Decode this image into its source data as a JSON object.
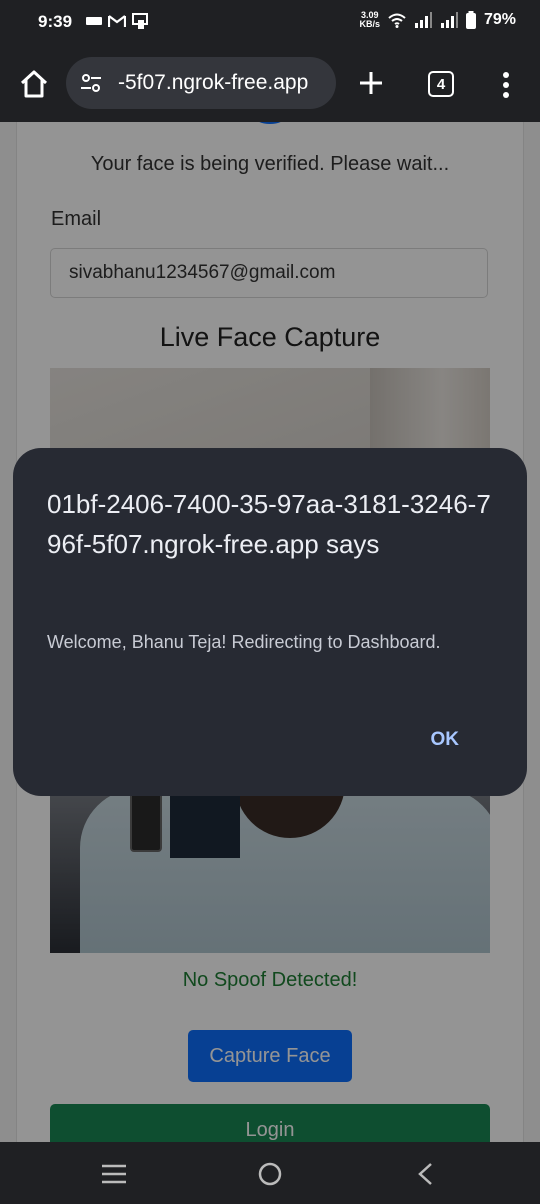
{
  "status_bar": {
    "time": "9:39",
    "net_speed_value": "3.09",
    "net_speed_unit": "KB/s",
    "battery": "79%"
  },
  "browser": {
    "url": "-5f07.ngrok-free.app",
    "tab_count": "4"
  },
  "page": {
    "verify_message": "Your face is being verified. Please wait...",
    "email_label": "Email",
    "email_value": "sivabhanu1234567@gmail.com",
    "capture_title": "Live Face Capture",
    "spoof_status": "No Spoof Detected!",
    "capture_button": "Capture Face",
    "login_button": "Login"
  },
  "dialog": {
    "title": "01bf-2406-7400-35-97aa-3181-3246-796f-5f07.ngrok-free.app says",
    "message": "Welcome, Bhanu Teja! Redirecting to Dashboard.",
    "ok_label": "OK"
  },
  "colors": {
    "primary_button": "#0d6efd",
    "success_button": "#198754",
    "success_text": "#1e7e34",
    "dialog_bg": "#272a33",
    "dialog_ok": "#a8c7ff"
  }
}
